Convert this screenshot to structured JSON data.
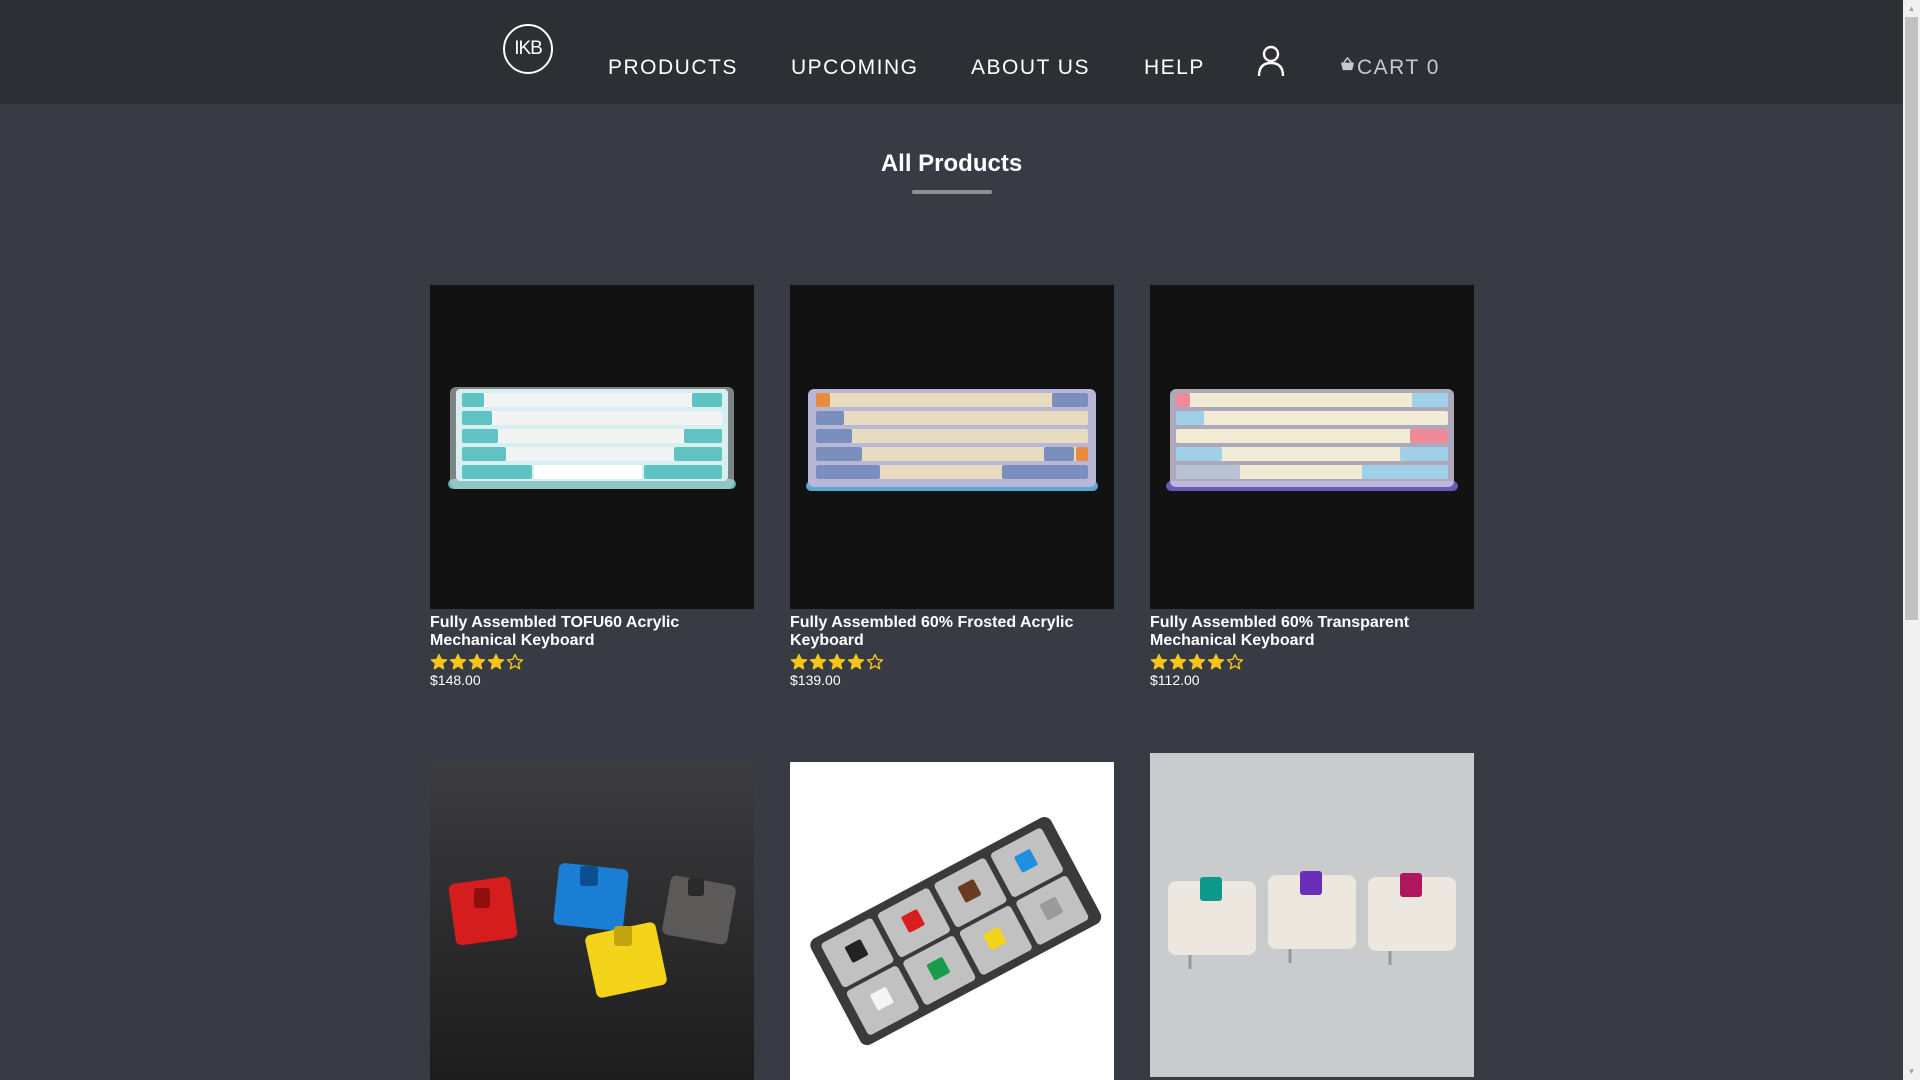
{
  "header": {
    "logo_text": "IKB",
    "nav": [
      "PRODUCTS",
      "UPCOMING",
      "ABOUT US",
      "HELP"
    ],
    "account_icon": "user-icon",
    "cart_icon": "basket-icon",
    "cart_label": "CART 0"
  },
  "main": {
    "title": "All Products",
    "products": [
      {
        "name": "Fully Assembled TOFU60 Acrylic Mechanical Keyboard",
        "rating": 4,
        "max_rating": 5,
        "price": "$148.00"
      },
      {
        "name": "Fully Assembled 60% Frosted Acrylic Keyboard",
        "rating": 4,
        "max_rating": 5,
        "price": "$139.00"
      },
      {
        "name": "Fully Assembled 60% Transparent Mechanical Keyboard",
        "rating": 4,
        "max_rating": 5,
        "price": "$112.00"
      },
      {
        "name": "",
        "rating": null,
        "price": ""
      },
      {
        "name": "",
        "rating": null,
        "price": ""
      },
      {
        "name": "",
        "rating": null,
        "price": ""
      }
    ]
  },
  "colors": {
    "page_bg": "#393b44",
    "header_bg": "#2d2f34",
    "star": "#f5c518",
    "accent_underline": "#8e9095"
  }
}
